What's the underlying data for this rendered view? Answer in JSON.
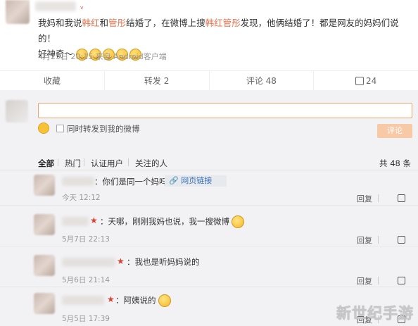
{
  "post": {
    "verified_mark": "ᵥ",
    "text_before_1": "我妈和我说",
    "name_1": "韩红",
    "text_and": "和",
    "name_2": "管彤",
    "text_after_1": "结婚了，在微博上搜",
    "name_3": "韩红",
    "name_4": "管彤",
    "text_after_2": "发现，他俩结婚了！都是网友的妈妈们说的！",
    "line_2": "好神奇～",
    "meta": "4月25日 20:15 来自 Android客户端"
  },
  "actions": {
    "favorite": "收藏",
    "forward": "转发 2",
    "comment": "评论 48",
    "like": "24"
  },
  "compose": {
    "sync_label": "同时转发到我的微博",
    "submit": "评论"
  },
  "tabs": {
    "all": "全部",
    "hot": "热门",
    "verified": "认证用户",
    "following": "关注的人",
    "total": "共 48 条"
  },
  "comments": [
    {
      "text": "：你们是同一个妈吗",
      "link": "网页链接",
      "time": "今天 12:12",
      "reply": "回复"
    },
    {
      "text": "：天哪，刚刚我妈也说，我一搜微博",
      "time": "5月7日 22:13",
      "reply": "回复"
    },
    {
      "text": "：我也是听妈妈说的",
      "time": "5月6日 21:14",
      "reply": "回复"
    },
    {
      "text": "：阿姨说的",
      "time": "5月5日 17:39",
      "reply": "回复"
    }
  ],
  "watermark": "新世纪手游",
  "colors": {
    "accent": "#eb7350",
    "link": "#3b6fb6",
    "submit_bg": "#f7c9a6"
  }
}
